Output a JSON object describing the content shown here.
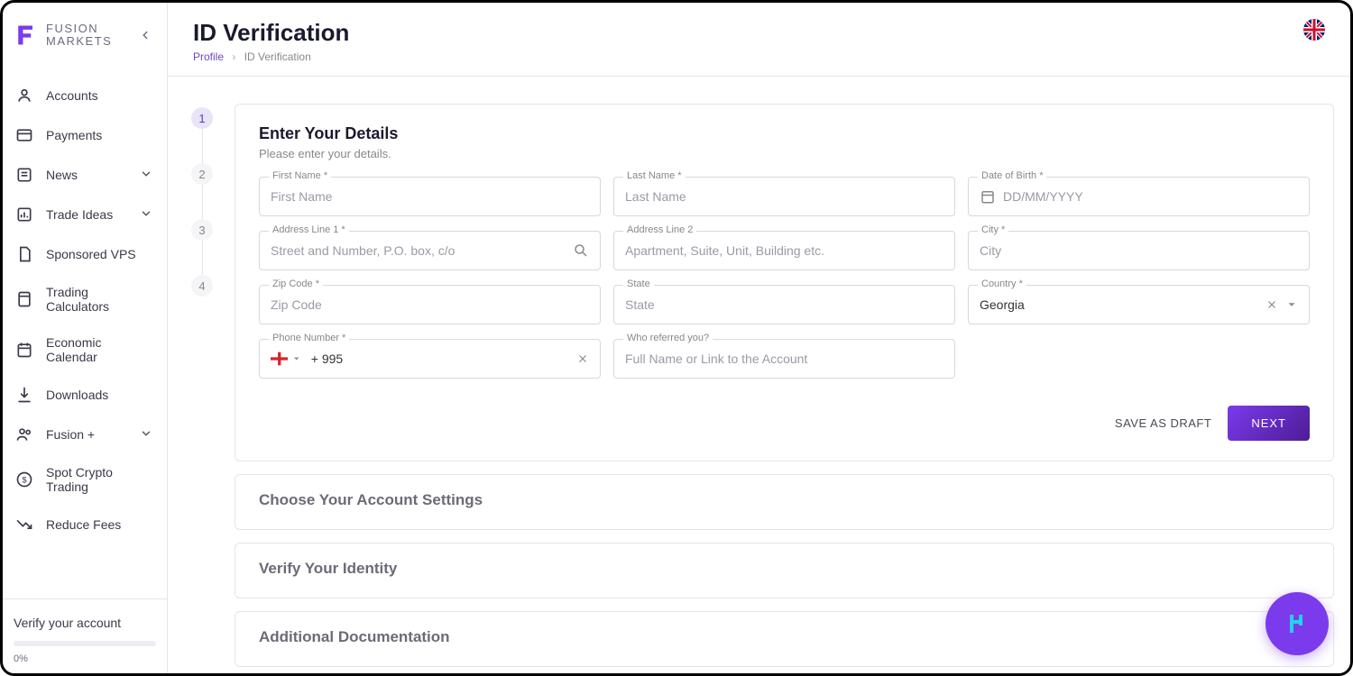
{
  "brand": {
    "line1": "FUSION",
    "line2": "MARKETS"
  },
  "sidebar": {
    "items": [
      {
        "label": "Accounts",
        "expandable": false
      },
      {
        "label": "Payments",
        "expandable": false
      },
      {
        "label": "News",
        "expandable": true
      },
      {
        "label": "Trade Ideas",
        "expandable": true
      },
      {
        "label": "Sponsored VPS",
        "expandable": false
      },
      {
        "label": "Trading Calculators",
        "expandable": false
      },
      {
        "label": "Economic Calendar",
        "expandable": false
      },
      {
        "label": "Downloads",
        "expandable": false
      },
      {
        "label": "Fusion +",
        "expandable": true
      },
      {
        "label": "Spot Crypto Trading",
        "expandable": false
      },
      {
        "label": "Reduce Fees",
        "expandable": false
      }
    ],
    "verify_label": "Verify your account",
    "verify_pct": "0%"
  },
  "header": {
    "title": "ID Verification",
    "breadcrumb_link": "Profile",
    "breadcrumb_current": "ID Verification"
  },
  "stepper": {
    "s1": "1",
    "s2": "2",
    "s3": "3",
    "s4": "4"
  },
  "step1": {
    "title": "Enter Your Details",
    "subtitle": "Please enter your details.",
    "fields": {
      "first_name": {
        "label": "First Name *",
        "placeholder": "First Name"
      },
      "last_name": {
        "label": "Last Name *",
        "placeholder": "Last Name"
      },
      "dob": {
        "label": "Date of Birth *",
        "placeholder": "DD/MM/YYYY"
      },
      "addr1": {
        "label": "Address Line 1 *",
        "placeholder": "Street and Number, P.O. box, c/o"
      },
      "addr2": {
        "label": "Address Line 2",
        "placeholder": "Apartment, Suite, Unit, Building etc."
      },
      "city": {
        "label": "City *",
        "placeholder": "City"
      },
      "zip": {
        "label": "Zip Code *",
        "placeholder": "Zip Code"
      },
      "state": {
        "label": "State",
        "placeholder": "State"
      },
      "country": {
        "label": "Country *",
        "value": "Georgia"
      },
      "phone": {
        "label": "Phone Number *",
        "value": "+ 995"
      },
      "referral": {
        "label": "Who referred you?",
        "placeholder": "Full Name or Link to the Account"
      }
    },
    "save_draft": "SAVE AS DRAFT",
    "next": "NEXT"
  },
  "step2": {
    "title": "Choose Your Account Settings"
  },
  "step3": {
    "title": "Verify Your Identity"
  },
  "step4": {
    "title": "Additional Documentation"
  }
}
